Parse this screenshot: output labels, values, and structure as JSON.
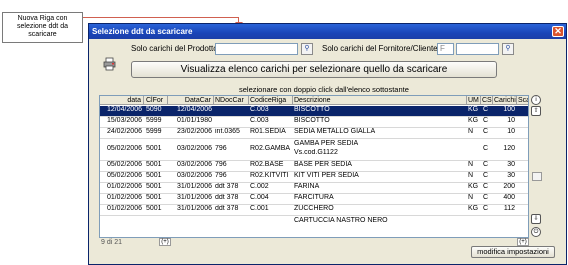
{
  "callout": {
    "line1": "Nuova Riga con",
    "line2": "selezione ddt da",
    "line3": "scaricare"
  },
  "window": {
    "title": "Selezione ddt da scaricare",
    "close_glyph": "✕"
  },
  "filters": {
    "prodotto_label": "Solo carichi del Prodotto",
    "prodotto_value": "",
    "fornitore_label": "Solo carichi del Fornitore/Cliente",
    "fornitore_code": "F",
    "fornitore_value": ""
  },
  "main_button": "Visualizza elenco carichi per selezionare quello da scaricare",
  "hint": "selezionare con doppio click dall'elenco sottostante",
  "grid": {
    "headers": [
      "data",
      "ClFor",
      "DataCar",
      "NDocCar",
      "CodiceRiga",
      "Descrizione",
      "UM",
      "CS",
      "Carichi",
      "Scar"
    ],
    "rows": [
      {
        "data": "12/04/2006",
        "clfor": "5090",
        "datacar": "12/04/2006",
        "ndoc": "",
        "codice": "C.003",
        "descr": "BISCOTTO",
        "um": "KG",
        "cs": "C",
        "carichi": "100",
        "scar": "",
        "selected": true
      },
      {
        "data": "15/03/2006",
        "clfor": "5999",
        "datacar": "01/01/1980",
        "ndoc": "",
        "codice": "C.003",
        "descr": "BISCOTTO",
        "um": "KG",
        "cs": "C",
        "carichi": "10",
        "scar": ""
      },
      {
        "data": "24/02/2006",
        "clfor": "5999",
        "datacar": "23/02/2006",
        "ndoc": "int.0365",
        "codice": "R01.SEDIA",
        "descr": "SEDIA METALLO GIALLA",
        "um": "N",
        "cs": "C",
        "carichi": "10",
        "scar": ""
      },
      {
        "data": "05/02/2006",
        "clfor": "5001",
        "datacar": "03/02/2006",
        "ndoc": "796",
        "codice": "R02.GAMBA",
        "descr": "GAMBA PER SEDIA",
        "descr2": "Vs.cod.G1122",
        "um": "",
        "cs": "C",
        "carichi": "120",
        "scar": ""
      },
      {
        "data": "05/02/2006",
        "clfor": "5001",
        "datacar": "03/02/2006",
        "ndoc": "796",
        "codice": "R02.BASE",
        "descr": "BASE PER SEDIA",
        "um": "N",
        "cs": "C",
        "carichi": "30",
        "scar": ""
      },
      {
        "data": "05/02/2006",
        "clfor": "5001",
        "datacar": "03/02/2006",
        "ndoc": "796",
        "codice": "R02.KITVITI",
        "descr": "KIT VITI PER SEDIA",
        "um": "N",
        "cs": "C",
        "carichi": "30",
        "scar": ""
      },
      {
        "data": "01/02/2006",
        "clfor": "5001",
        "datacar": "31/01/2006",
        "ndoc": "ddt 378",
        "codice": "C.002",
        "descr": "FARINA",
        "um": "KG",
        "cs": "C",
        "carichi": "200",
        "scar": ""
      },
      {
        "data": "01/02/2006",
        "clfor": "5001",
        "datacar": "31/01/2006",
        "ndoc": "ddt 378",
        "codice": "C.004",
        "descr": "FARCITURA",
        "um": "N",
        "cs": "C",
        "carichi": "400",
        "scar": ""
      },
      {
        "data": "01/02/2006",
        "clfor": "5001",
        "datacar": "31/01/2006",
        "ndoc": "ddt 378",
        "codice": "C.001",
        "descr": "ZUCCHERO",
        "um": "KG",
        "cs": "C",
        "carichi": "112",
        "scar": ""
      },
      {
        "data": "",
        "clfor": "",
        "datacar": "",
        "ndoc": "",
        "codice": "",
        "descr": "CARTUCCIA NASTRO NERO",
        "um": "",
        "cs": "",
        "carichi": "",
        "scar": ""
      }
    ]
  },
  "record_counter": "9 di 21",
  "nav_prev": "(+)",
  "nav_next": "(+)",
  "modifica_button": "modifica impostazioni",
  "icons": {
    "binocular": "⚲",
    "info": "i",
    "print": "printer",
    "up": "⇧",
    "down": "⇩",
    "power": "⏻"
  }
}
